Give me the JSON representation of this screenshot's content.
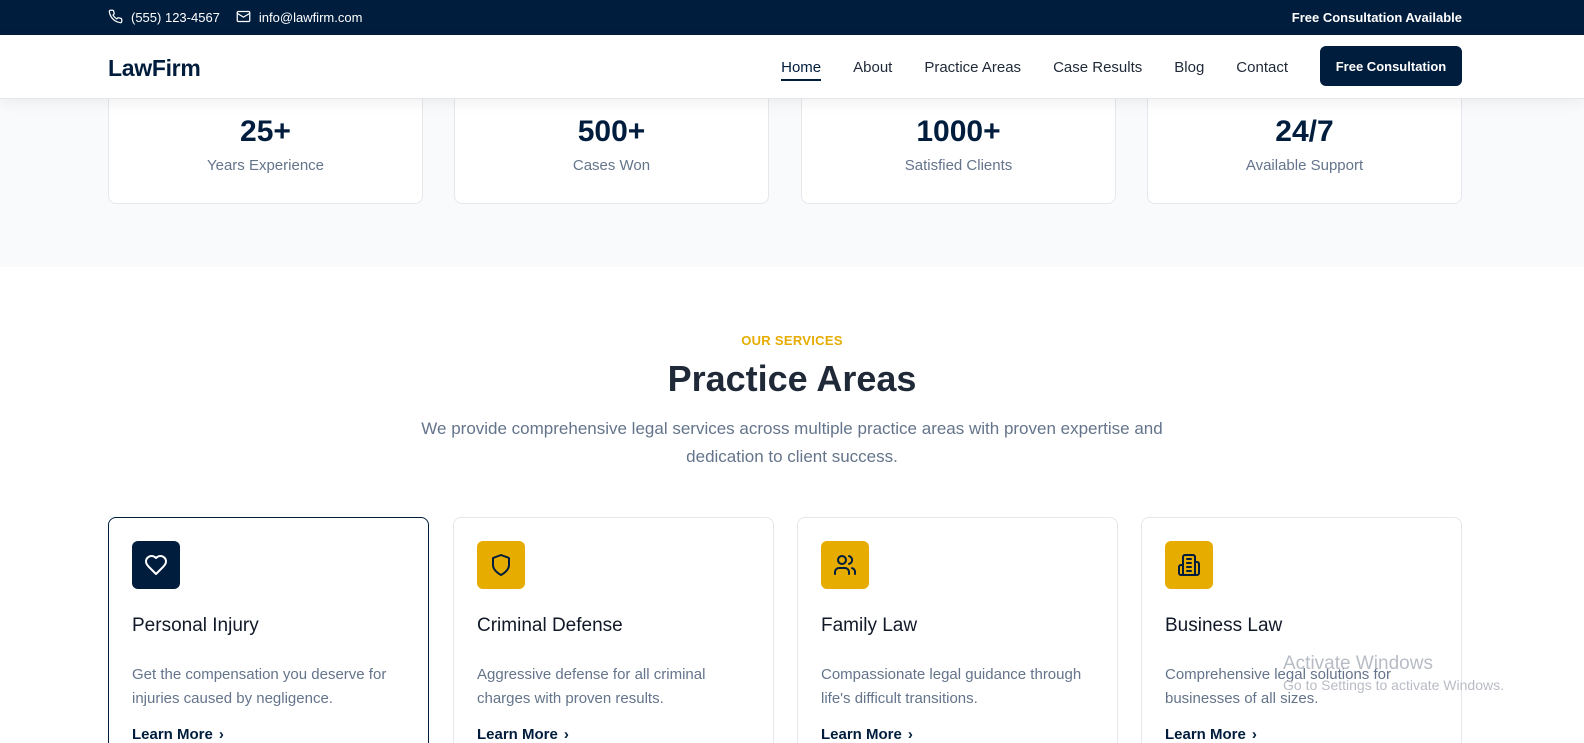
{
  "topbar": {
    "phone": "(555) 123-4567",
    "email": "info@lawfirm.com",
    "right_text": "Free Consultation Available"
  },
  "header": {
    "logo": "LawFirm",
    "nav": [
      {
        "label": "Home",
        "active": true
      },
      {
        "label": "About"
      },
      {
        "label": "Practice Areas"
      },
      {
        "label": "Case Results"
      },
      {
        "label": "Blog"
      },
      {
        "label": "Contact"
      }
    ],
    "cta": "Free Consultation"
  },
  "stats": [
    {
      "value": "25+",
      "label": "Years Experience"
    },
    {
      "value": "500+",
      "label": "Cases Won"
    },
    {
      "value": "1000+",
      "label": "Satisfied Clients"
    },
    {
      "value": "24/7",
      "label": "Available Support"
    }
  ],
  "services": {
    "eyebrow": "OUR SERVICES",
    "title": "Practice Areas",
    "subtitle": "We provide comprehensive legal services across multiple practice areas with proven expertise and dedication to client success.",
    "cards": [
      {
        "title": "Personal Injury",
        "description": "Get the compensation you deserve for injuries caused by negligence.",
        "link": "Learn More",
        "icon": "heart-icon"
      },
      {
        "title": "Criminal Defense",
        "description": "Aggressive defense for all criminal charges with proven results.",
        "link": "Learn More",
        "icon": "shield-icon"
      },
      {
        "title": "Family Law",
        "description": "Compassionate legal guidance through life's difficult transitions.",
        "link": "Learn More",
        "icon": "users-icon"
      },
      {
        "title": "Business Law",
        "description": "Comprehensive legal solutions for businesses of all sizes.",
        "link": "Learn More",
        "icon": "building-icon"
      }
    ]
  },
  "watermark": {
    "line1": "Activate Windows",
    "line2": "Go to Settings to activate Windows."
  },
  "colors": {
    "navy": "#001d3d",
    "gold": "#e6ac00",
    "muted": "#64748b"
  }
}
